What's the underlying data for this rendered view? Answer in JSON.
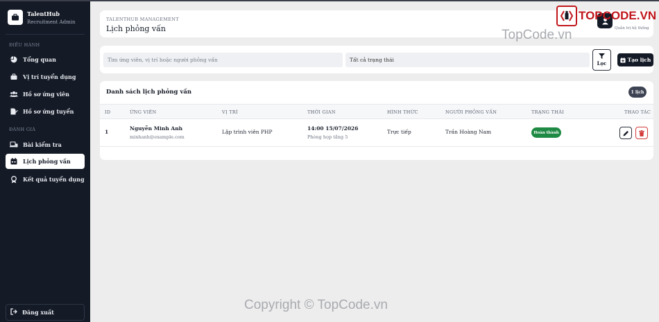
{
  "brand": {
    "name": "TalentHub",
    "subtitle": "Recruitment Admin"
  },
  "sidebar": {
    "sections": [
      {
        "label": "ĐIỀU HÀNH"
      },
      {
        "label": "ĐÁNH GIÁ"
      }
    ],
    "items": [
      {
        "label": "Tổng quan",
        "icon": "pie-chart-icon"
      },
      {
        "label": "Vị trí tuyển dụng",
        "icon": "briefcase-icon"
      },
      {
        "label": "Hồ sơ ứng viên",
        "icon": "users-icon"
      },
      {
        "label": "Hồ sơ ứng tuyển",
        "icon": "file-signature-icon"
      },
      {
        "label": "Bài kiểm tra",
        "icon": "laptop-file-icon"
      },
      {
        "label": "Lịch phỏng vấn",
        "icon": "calendar-icon",
        "active": true
      },
      {
        "label": "Kết quả tuyển dụng",
        "icon": "award-icon"
      }
    ],
    "logout_label": "Đăng xuất"
  },
  "header": {
    "kicker": "TALENTHUB MANAGEMENT",
    "title": "Lịch phỏng vấn",
    "user_role": "Quản trị hệ thống"
  },
  "filters": {
    "search_placeholder": "Tìm ứng viên, vị trí hoặc người phỏng vấn",
    "status_selected": "Tất cả trạng thái",
    "filter_label": "Lọc",
    "create_label": "Tạo lịch"
  },
  "table": {
    "title": "Danh sách lịch phỏng vấn",
    "count_badge": "1 lịch",
    "columns": [
      "ID",
      "ỨNG VIÊN",
      "VỊ TRÍ",
      "THỜI GIAN",
      "HÌNH THỨC",
      "NGƯỜI PHỎNG VẤN",
      "TRẠNG THÁI",
      "THAO TÁC"
    ],
    "rows": [
      {
        "id": "1",
        "candidate_name": "Nguyễn Minh Anh",
        "candidate_email": "minhanh@example.com",
        "position": "Lập trình viên PHP",
        "time": "14:00 15/07/2026",
        "location": "Phòng họp tầng 5",
        "format": "Trực tiếp",
        "interviewer": "Trần Hoàng Nam",
        "status": "Hoàn thành"
      }
    ]
  },
  "watermarks": {
    "logo_text": "TOPCODE.VN",
    "site": "TopCode.vn",
    "copyright": "Copyright © TopCode.vn"
  },
  "colors": {
    "sidebar_bg": "#141a26",
    "page_bg": "#ededed",
    "status_success": "#1e8a43",
    "danger": "#d33a3a",
    "watermark_red": "#c0161c"
  }
}
